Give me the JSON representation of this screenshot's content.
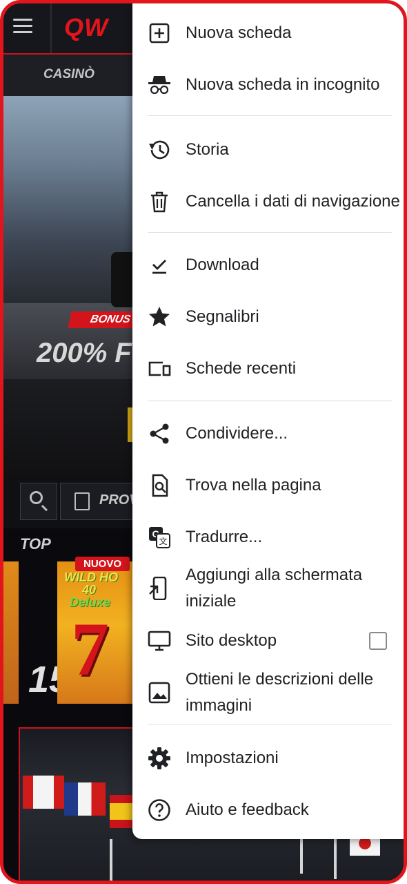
{
  "background_page": {
    "logo": "QW",
    "nav_item": "CASINÒ",
    "bonus_tag": "BONUS",
    "bonus_value": "200% F",
    "promo_label": "PROV",
    "section_label": "TOP",
    "game_badge": "NUOVO",
    "game_title_line1": "WILD HO",
    "game_title_line2": "40",
    "game_title_line3": "Deluxe",
    "game_big_number": "7",
    "side_number": "15"
  },
  "menu": {
    "new_tab": "Nuova scheda",
    "new_incognito_tab": "Nuova scheda in incognito",
    "history": "Storia",
    "clear_browsing_data": "Cancella i dati di navigazione",
    "downloads": "Download",
    "bookmarks": "Segnalibri",
    "recent_tabs": "Schede recenti",
    "share": "Condividere...",
    "find_in_page": "Trova nella pagina",
    "translate": "Tradurre...",
    "add_to_home": "Aggiungi alla schermata iniziale",
    "desktop_site": "Sito desktop",
    "desktop_site_checked": false,
    "image_descriptions": "Ottieni le descrizioni delle immagini",
    "settings": "Impostazioni",
    "help_feedback": "Aiuto e feedback"
  },
  "colors": {
    "frame_accent": "#e0161c",
    "menu_background": "#ffffff",
    "menu_text": "#202124"
  }
}
